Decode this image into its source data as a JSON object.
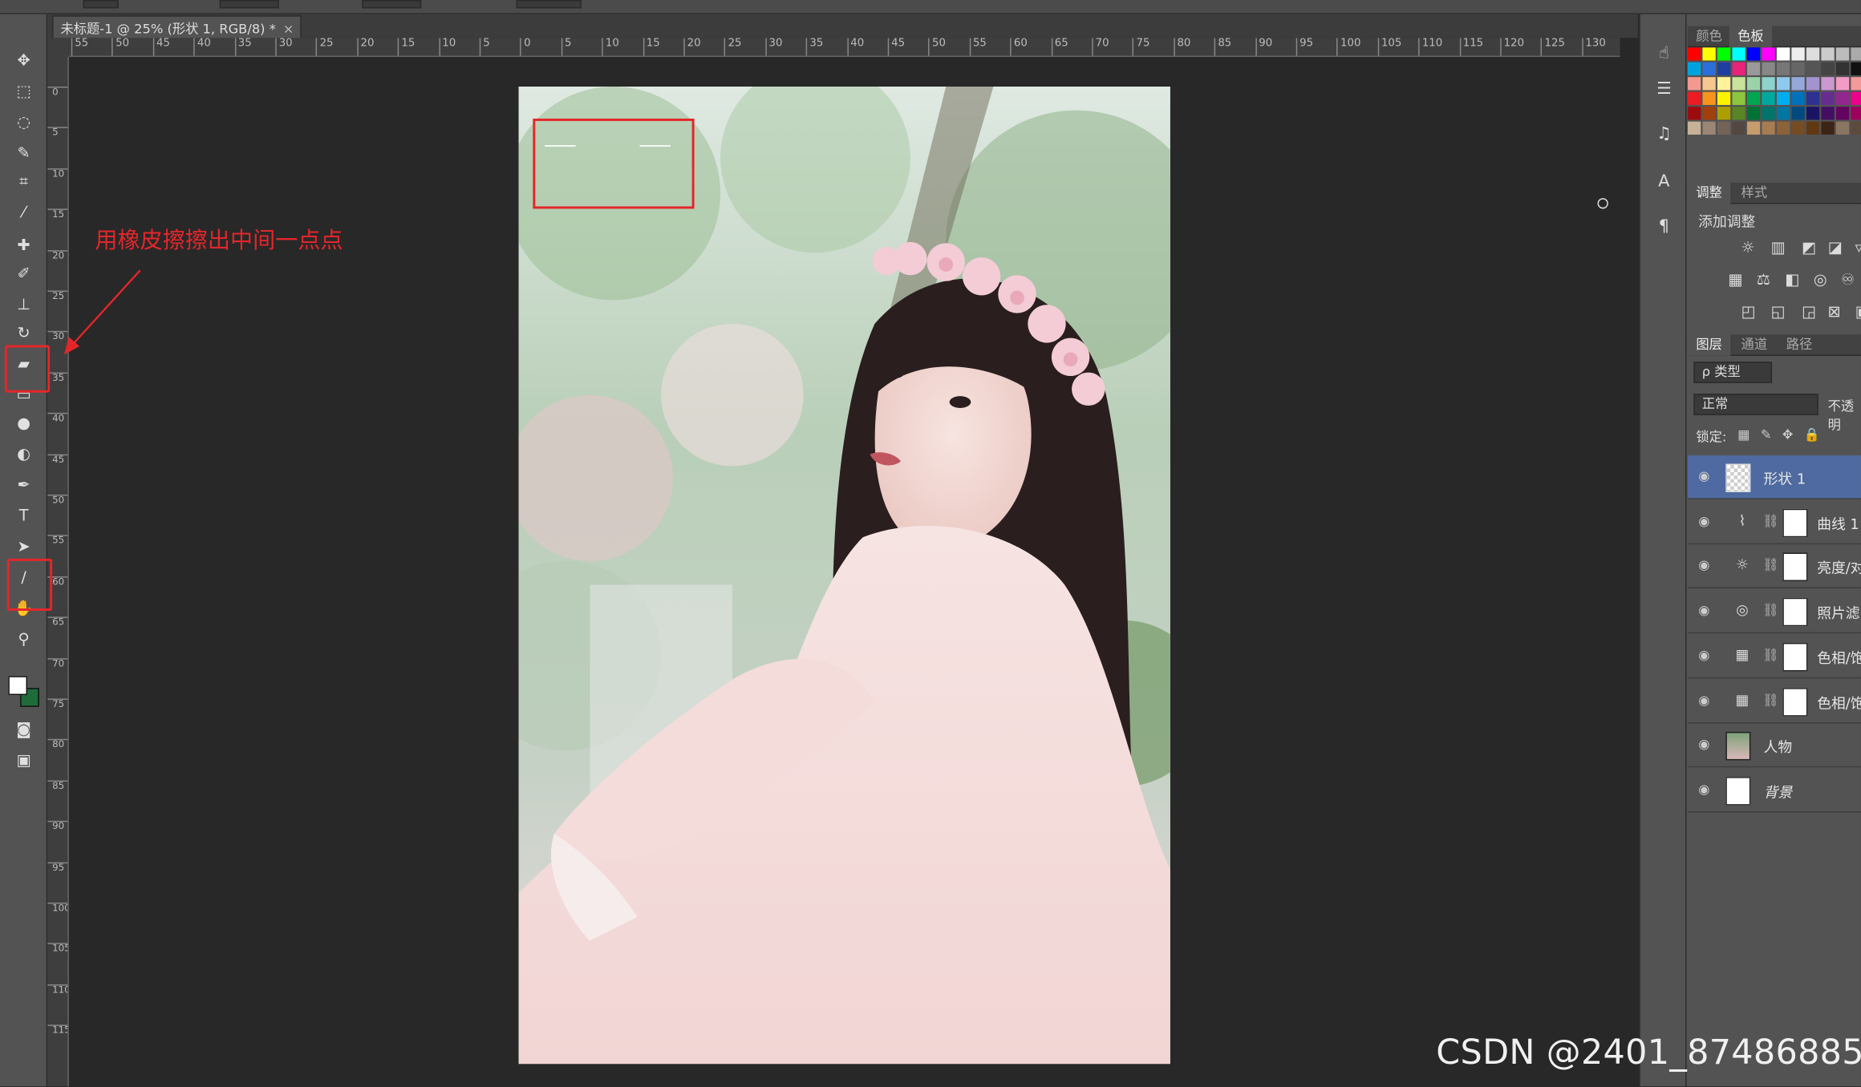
{
  "document_tab": {
    "title": "未标题-1 @ 25% (形状 1, RGB/8) *",
    "close": "×"
  },
  "rulers": {
    "horizontal": [
      "55",
      "50",
      "45",
      "40",
      "35",
      "30",
      "25",
      "20",
      "15",
      "10",
      "5",
      "0",
      "5",
      "10",
      "15",
      "20",
      "25",
      "30",
      "35",
      "40",
      "45",
      "50",
      "55",
      "60",
      "65",
      "70",
      "75",
      "80",
      "85",
      "90",
      "95",
      "100",
      "105",
      "110",
      "115",
      "120",
      "125",
      "130"
    ],
    "vertical": [
      "0",
      "5",
      "10",
      "15",
      "20",
      "25",
      "30",
      "35",
      "40",
      "45",
      "50",
      "55",
      "60",
      "65",
      "70",
      "75",
      "80",
      "85",
      "90",
      "95",
      "100",
      "105",
      "110",
      "115"
    ]
  },
  "annotation": {
    "text": "用橡皮擦擦出中间一点点",
    "color": "#e4262b"
  },
  "toolbar": {
    "tools": [
      {
        "name": "move-tool",
        "glyph": "✥"
      },
      {
        "name": "marquee-tool",
        "glyph": "⬚"
      },
      {
        "name": "lasso-tool",
        "glyph": "◌"
      },
      {
        "name": "quick-select-tool",
        "glyph": "✎"
      },
      {
        "name": "crop-tool",
        "glyph": "⌗"
      },
      {
        "name": "eyedropper-tool",
        "glyph": "⁄"
      },
      {
        "name": "healing-brush-tool",
        "glyph": "✚"
      },
      {
        "name": "brush-tool",
        "glyph": "✐"
      },
      {
        "name": "clone-stamp-tool",
        "glyph": "⊥"
      },
      {
        "name": "history-brush-tool",
        "glyph": "↻"
      },
      {
        "name": "eraser-tool",
        "glyph": "▰"
      },
      {
        "name": "gradient-tool",
        "glyph": "▭"
      },
      {
        "name": "blur-tool",
        "glyph": "●"
      },
      {
        "name": "dodge-tool",
        "glyph": "◐"
      },
      {
        "name": "pen-tool",
        "glyph": "✒"
      },
      {
        "name": "type-tool",
        "glyph": "T"
      },
      {
        "name": "path-select-tool",
        "glyph": "➤"
      },
      {
        "name": "line-tool",
        "glyph": "∕"
      },
      {
        "name": "hand-tool",
        "glyph": "✋"
      },
      {
        "name": "zoom-tool",
        "glyph": "⚲"
      }
    ],
    "foreground_color": "#ffffff",
    "background_color": "#1f6b3a"
  },
  "panels": {
    "color_tabs": [
      "颜色",
      "色板"
    ],
    "adjust_tabs": [
      "调整",
      "样式"
    ],
    "add_adjustment": "添加调整",
    "layer_tabs": [
      "图层",
      "通道",
      "路径"
    ],
    "filter_kind": "ρ 类型",
    "blend_mode": "正常",
    "opacity_label": "不透明",
    "lock_label": "锁定:"
  },
  "layers": [
    {
      "name": "形状 1",
      "type": "shape",
      "active": true
    },
    {
      "name": "曲线 1",
      "type": "adjustment",
      "icon": "curves-icon",
      "glyph": "⌇"
    },
    {
      "name": "亮度/对",
      "type": "adjustment",
      "icon": "brightness-icon",
      "glyph": "☼"
    },
    {
      "name": "照片滤",
      "type": "adjustment",
      "icon": "photo-filter-icon",
      "glyph": "◎"
    },
    {
      "name": "色相/饱",
      "type": "adjustment",
      "icon": "hue-saturation-icon",
      "glyph": "▦"
    },
    {
      "name": "色相/饱",
      "type": "adjustment",
      "icon": "hue-saturation-icon",
      "glyph": "▦"
    },
    {
      "name": "人物",
      "type": "image"
    },
    {
      "name": "背景",
      "type": "background"
    }
  ],
  "watermark": "CSDN @2401_87486885"
}
